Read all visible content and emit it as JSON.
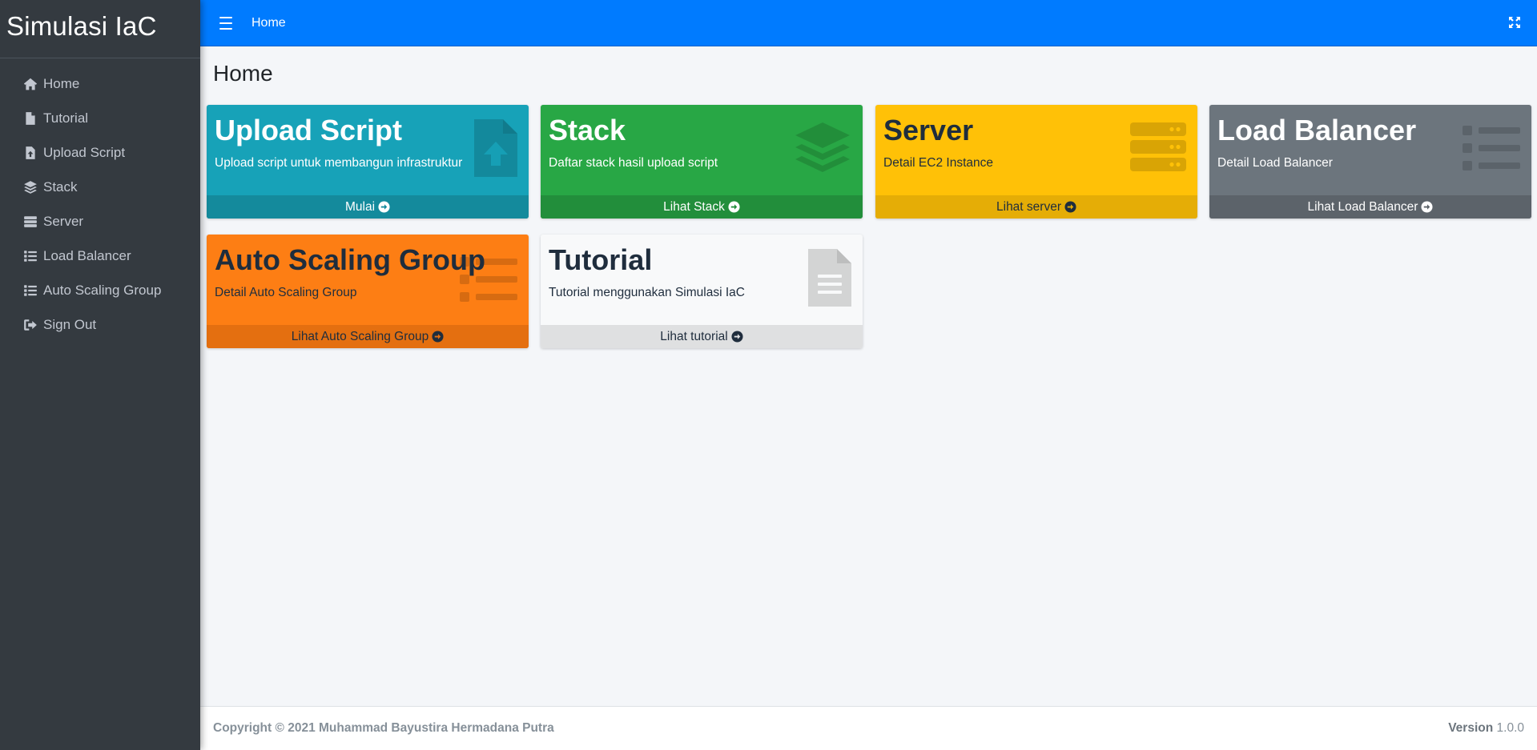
{
  "brand": {
    "title": "Simulasi IaC"
  },
  "sidebar": {
    "items": [
      {
        "label": "Home",
        "icon": "home-icon"
      },
      {
        "label": "Tutorial",
        "icon": "file-icon"
      },
      {
        "label": "Upload Script",
        "icon": "file-upload-icon"
      },
      {
        "label": "Stack",
        "icon": "layer-group-icon"
      },
      {
        "label": "Server",
        "icon": "server-icon"
      },
      {
        "label": "Load Balancer",
        "icon": "list-icon"
      },
      {
        "label": "Auto Scaling Group",
        "icon": "list-icon"
      },
      {
        "label": "Sign Out",
        "icon": "sign-out-icon"
      }
    ]
  },
  "topbar": {
    "home_link": "Home",
    "menu_icon": "hamburger-icon",
    "fullscreen_icon": "expand-icon"
  },
  "page": {
    "title": "Home"
  },
  "cards": [
    {
      "title": "Upload Script",
      "desc": "Upload script untuk membangun infrastruktur",
      "link": "Mulai",
      "icon": "file-upload-icon",
      "color": "#17a2b8"
    },
    {
      "title": "Stack",
      "desc": "Daftar stack hasil upload script",
      "link": "Lihat Stack",
      "icon": "layer-group-icon",
      "color": "#28a745"
    },
    {
      "title": "Server",
      "desc": "Detail EC2 Instance",
      "link": "Lihat server",
      "icon": "server-icon",
      "color": "#ffc107"
    },
    {
      "title": "Load Balancer",
      "desc": "Detail Load Balancer",
      "link": "Lihat Load Balancer",
      "icon": "list-icon",
      "color": "#6c757d"
    },
    {
      "title": "Auto Scaling Group",
      "desc": "Detail Auto Scaling Group",
      "link": "Lihat Auto Scaling Group",
      "icon": "list-icon",
      "color": "#fd7e14"
    },
    {
      "title": "Tutorial",
      "desc": "Tutorial menggunakan Simulasi IaC",
      "link": "Lihat tutorial",
      "icon": "file-text-icon",
      "color": "#f8f9fa"
    }
  ],
  "footer": {
    "copyright": "Copyright © 2021 Muhammad Bayustira Hermadana Putra",
    "version_label": "Version",
    "version_number": "1.0.0"
  }
}
